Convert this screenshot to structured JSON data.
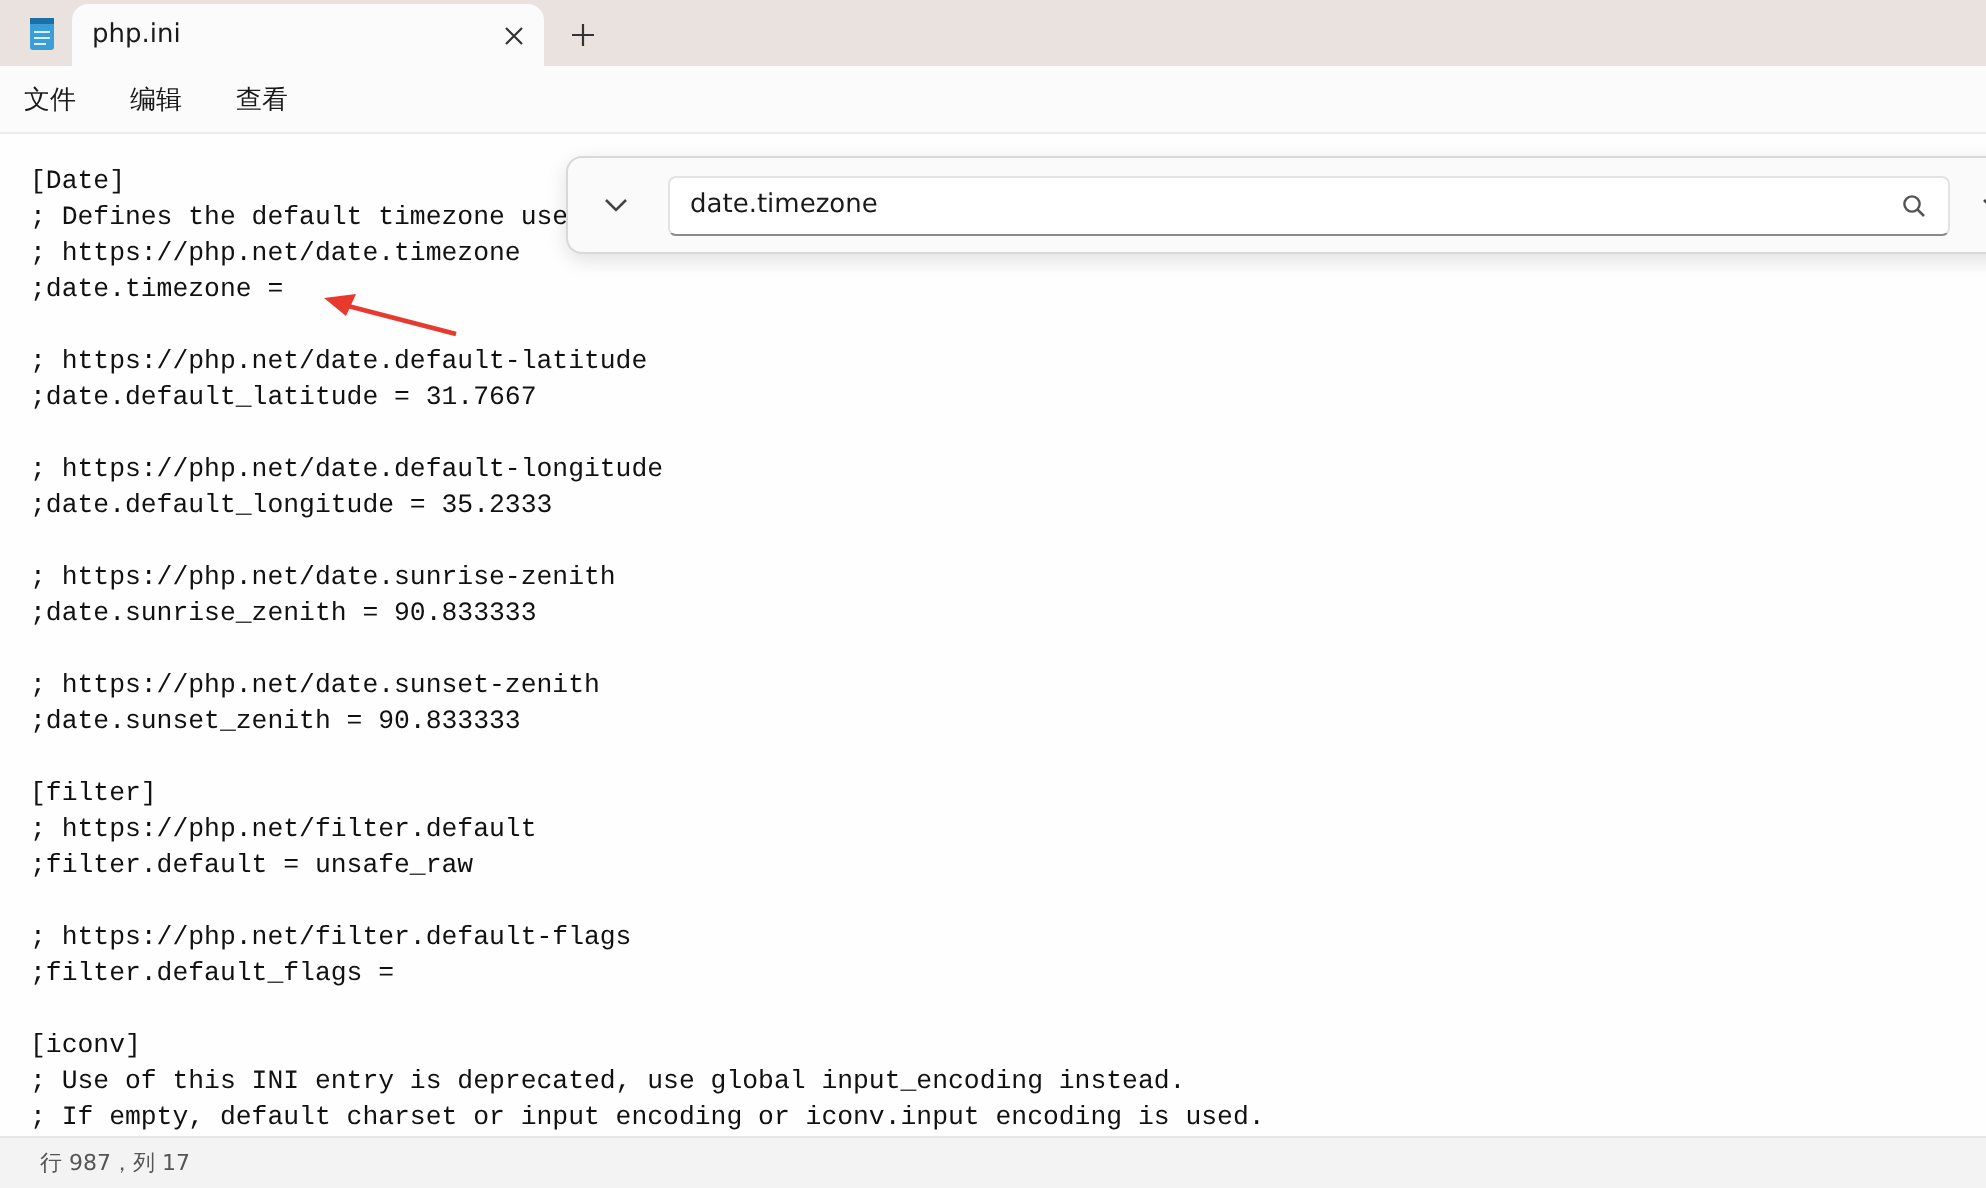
{
  "tabs": [
    {
      "label": "php.ini",
      "selected": true
    }
  ],
  "menu": [
    "文件",
    "编辑",
    "查看"
  ],
  "find": {
    "value": "date.timezone"
  },
  "blocks": [
    [
      "[Date]",
      "; Defines the default timezone use",
      "; https://php.net/date.timezone",
      ";date.timezone ="
    ],
    [
      "; https://php.net/date.default-latitude",
      ";date.default_latitude = 31.7667"
    ],
    [
      "; https://php.net/date.default-longitude",
      ";date.default_longitude = 35.2333"
    ],
    [
      "; https://php.net/date.sunrise-zenith",
      ";date.sunrise_zenith = 90.833333"
    ],
    [
      "; https://php.net/date.sunset-zenith",
      ";date.sunset_zenith = 90.833333"
    ],
    [
      "[filter]",
      "; https://php.net/filter.default",
      ";filter.default = unsafe_raw"
    ],
    [
      "; https://php.net/filter.default-flags",
      ";filter.default_flags ="
    ],
    [
      "[iconv]",
      "; Use of this INI entry is deprecated, use global input_encoding instead.",
      "; If empty, default charset or input encoding or iconv.input encoding is used."
    ]
  ],
  "status_bar": {
    "position": "行 987，列 17"
  }
}
